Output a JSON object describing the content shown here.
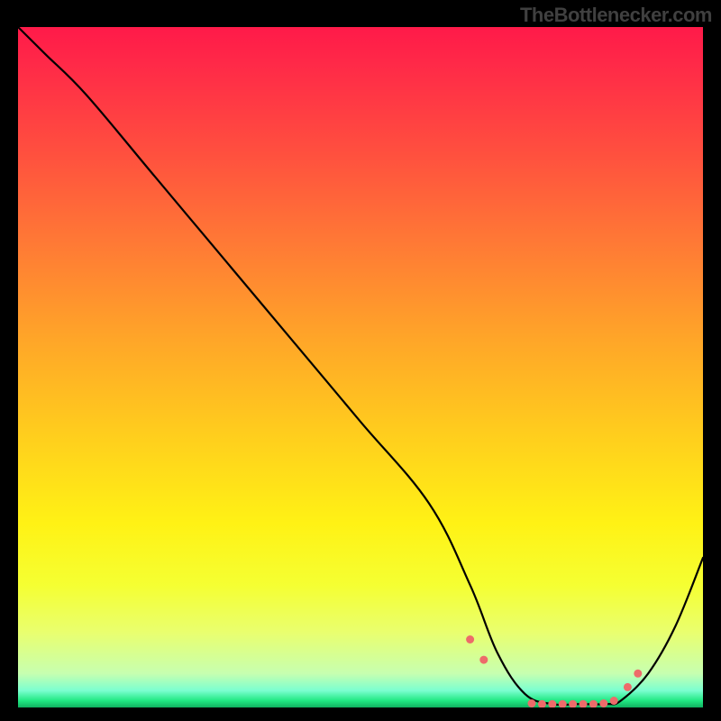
{
  "attribution": "TheBottlenecker.com",
  "colors": {
    "background": "#000000",
    "gradient_top": "#ff1a49",
    "gradient_mid_upper": "#ffa628",
    "gradient_mid_lower": "#fff215",
    "gradient_bottom": "#10b060",
    "curve_stroke": "#000000",
    "marker_fill": "#ed6b6a"
  },
  "chart_data": {
    "type": "line",
    "title": "",
    "xlabel": "",
    "ylabel": "",
    "xlim": [
      0,
      100
    ],
    "ylim": [
      0,
      100
    ],
    "x": [
      0,
      4,
      10,
      20,
      30,
      40,
      50,
      60,
      66,
      70,
      74,
      78,
      82,
      86,
      88,
      92,
      96,
      100
    ],
    "values": [
      100,
      96,
      90,
      78,
      66,
      54,
      42,
      30,
      18,
      8,
      2,
      0.5,
      0.5,
      0.5,
      1,
      5,
      12,
      22
    ],
    "markers": {
      "x": [
        66,
        68,
        75,
        76.5,
        78,
        79.5,
        81,
        82.5,
        84,
        85.5,
        87,
        89,
        90.5
      ],
      "y": [
        10,
        7,
        0.6,
        0.5,
        0.5,
        0.5,
        0.5,
        0.5,
        0.5,
        0.6,
        1,
        3,
        5
      ]
    }
  }
}
